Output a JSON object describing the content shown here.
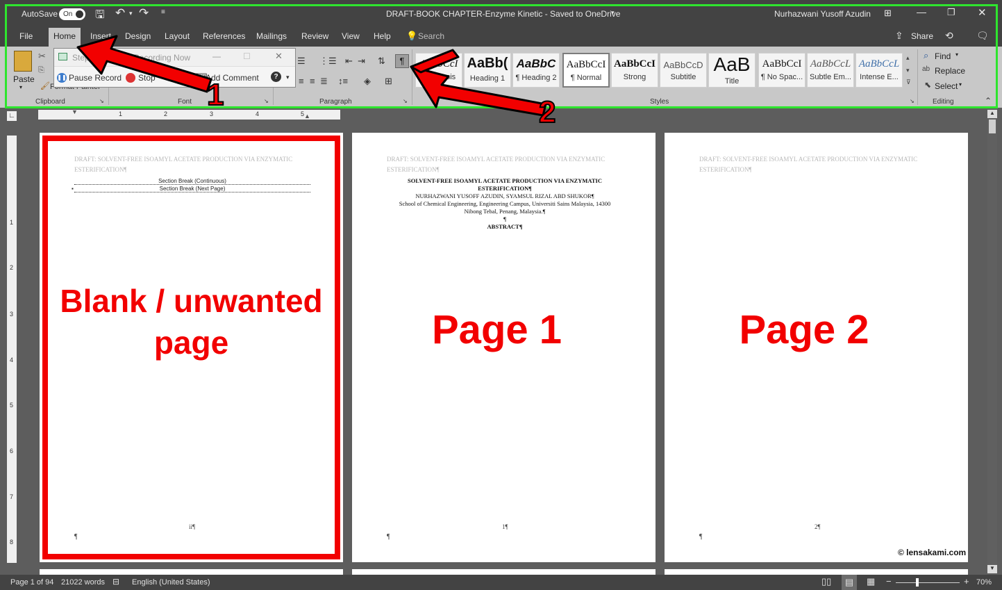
{
  "titlebar": {
    "autosave_label": "AutoSave",
    "autosave_state": "On",
    "doc_title": "DRAFT-BOOK CHAPTER-Enzyme Kinetic  -  Saved to OneDrive",
    "user_name": "Nurhazwani Yusoff Azudin"
  },
  "tabs": [
    "File",
    "Home",
    "Insert",
    "Design",
    "Layout",
    "References",
    "Mailings",
    "Review",
    "View",
    "Help"
  ],
  "search_placeholder": "Search",
  "share_label": "Share",
  "clipboard": {
    "paste_label": "Paste",
    "format_painter": "Format Painter",
    "group_label": "Clipboard"
  },
  "font_group_label": "Font",
  "paragraph_group_label": "Paragraph",
  "styles_group_label": "Styles",
  "editing_group_label": "Editing",
  "styles": [
    {
      "preview": "AaBbCcI",
      "name": "Emphasis"
    },
    {
      "preview": "AaBb(",
      "name": "Heading 1"
    },
    {
      "preview": "AaBbC",
      "name": "¶ Heading 2"
    },
    {
      "preview": "AaBbCcI",
      "name": "¶ Normal"
    },
    {
      "preview": "AaBbCcI",
      "name": "Strong"
    },
    {
      "preview": "AaBbCcD",
      "name": "Subtitle"
    },
    {
      "preview": "AaB",
      "name": "Title"
    },
    {
      "preview": "AaBbCcI",
      "name": "¶ No Spac..."
    },
    {
      "preview": "AaBbCcL",
      "name": "Subtle Em..."
    },
    {
      "preview": "AaBbCcL",
      "name": "Intense E..."
    }
  ],
  "editing": {
    "find": "Find",
    "replace": "Replace",
    "select": "Select"
  },
  "steps_recorder": {
    "title": "Steps",
    "status": "Recording Now",
    "pause": "Pause Record",
    "stop": "Stop",
    "add_comment": "Add Comment"
  },
  "ruler_h_numbers": [
    "1",
    "2",
    "3",
    "4",
    "5"
  ],
  "ruler_v_numbers": [
    "1",
    "2",
    "3",
    "4",
    "5",
    "6",
    "7",
    "8"
  ],
  "page_header": "DRAFT: SOLVENT-FREE ISOAMYL ACETATE PRODUCTION VIA ENZYMATIC ESTERIFICATION¶",
  "pages": [
    {
      "section_break_1": "Section Break (Continuous)",
      "section_break_2": "Section Break (Next Page)",
      "page_number": "ii¶",
      "pilcrow": "¶",
      "annotation": "Blank / unwanted page"
    },
    {
      "title_line1": "SOLVENT-FREE ISOAMYL ACETATE PRODUCTION VIA ENZYMATIC",
      "title_line2": "ESTERIFICATION¶",
      "authors": "NURHAZWANI YUSOFF AZUDIN, SYAMSUL RIZAL ABD SHUKOR¶",
      "affiliation1": "School of Chemical Engineering, Engineering Campus, Universiti Sains Malaysia, 14300",
      "affiliation2": "Nibong Tebal, Penang, Malaysia.¶",
      "pilcrow": "¶",
      "abstract": "ABSTRACT¶",
      "page_number": "1¶",
      "annotation": "Page 1"
    },
    {
      "page_number": "2¶",
      "pilcrow": "¶",
      "annotation": "Page 2",
      "watermark": "© lensakami.com"
    }
  ],
  "arrows": {
    "one": "1",
    "two": "2"
  },
  "status": {
    "page": "Page 1 of 94",
    "words": "21022 words",
    "language": "English (United States)",
    "zoom": "70%"
  },
  "colors": {
    "annotation_red": "#f20000",
    "highlight_green": "#2ee52e"
  }
}
